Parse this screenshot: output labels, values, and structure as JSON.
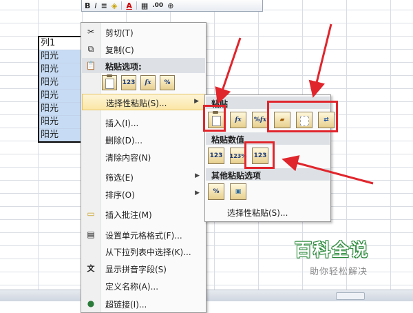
{
  "toolbar": {
    "items": [
      "B",
      "I",
      "≡",
      "A",
      "▦",
      ".00",
      "⊕"
    ]
  },
  "cells": {
    "header": "列1",
    "values": [
      "阳光",
      "阳光",
      "阳光",
      "阳光",
      "阳光",
      "阳光",
      "阳光"
    ]
  },
  "context_menu": {
    "cut": "剪切(T)",
    "copy": "复制(C)",
    "paste_options": "粘贴选项:",
    "paste_icons": [
      "clipboard",
      "123",
      "fx",
      "%"
    ],
    "paste_special": "选择性粘贴(S)...",
    "insert": "插入(I)...",
    "delete": "删除(D)...",
    "clear_contents": "清除内容(N)",
    "filter": "筛选(E)",
    "sort": "排序(O)",
    "insert_comment": "插入批注(M)",
    "format_cells": "设置单元格格式(F)...",
    "pick_from_list": "从下拉列表中选择(K)...",
    "phonetic": "显示拼音字段(S)",
    "define_name": "定义名称(A)...",
    "hyperlink": "超链接(I)..."
  },
  "submenu": {
    "paste_section": "粘贴",
    "paste_values_section": "粘贴数值",
    "other_paste_section": "其他粘贴选项",
    "paste_special_link": "选择性粘贴(S)...",
    "paste_row": [
      "page",
      "fx",
      "%fx",
      "brush",
      "border",
      "transpose"
    ],
    "values_row": [
      "123",
      "123%",
      "123brush"
    ],
    "other_row": [
      "%",
      "picture"
    ]
  },
  "watermark": {
    "logo": "百科全说",
    "tagline": "助你轻松解决"
  },
  "colors": {
    "highlight": "#fbe6a6",
    "selection": "#c7dcf4",
    "annotation_red": "#e0252c"
  }
}
